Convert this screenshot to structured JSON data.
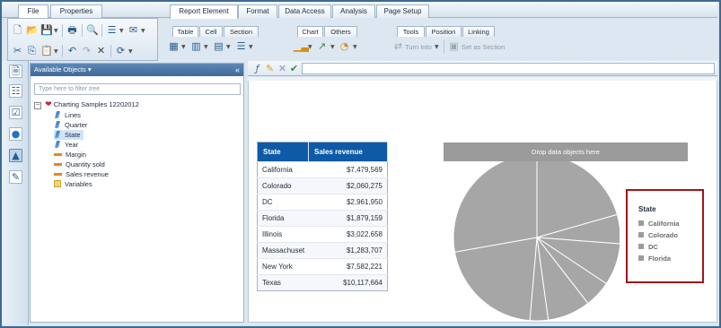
{
  "ribbon": {
    "tabs_left": [
      "File",
      "Properties"
    ],
    "tabs_main": [
      "Report Element",
      "Format",
      "Data Access",
      "Analysis",
      "Page Setup"
    ],
    "subtabs": [
      "Table",
      "Cell",
      "Section",
      "Chart",
      "Others",
      "Tools",
      "Position",
      "Linking"
    ],
    "turn_into": "Turn Into",
    "set_as_section": "Set as Section"
  },
  "objects_panel": {
    "title": "Available Objects",
    "filter_placeholder": "Type here to filter tree",
    "root": "Charting Samples 12202012",
    "items": [
      {
        "label": "Lines",
        "kind": "dimension"
      },
      {
        "label": "Quarter",
        "kind": "dimension"
      },
      {
        "label": "State",
        "kind": "dimension",
        "selected": true
      },
      {
        "label": "Year",
        "kind": "dimension"
      },
      {
        "label": "Margin",
        "kind": "measure"
      },
      {
        "label": "Quantity sold",
        "kind": "measure"
      },
      {
        "label": "Sales revenue",
        "kind": "measure"
      },
      {
        "label": "Variables",
        "kind": "folder"
      }
    ]
  },
  "table": {
    "headers": [
      "State",
      "Sales revenue"
    ],
    "rows": [
      [
        "California",
        "$7,479,569"
      ],
      [
        "Colorado",
        "$2,060,275"
      ],
      [
        "DC",
        "$2,961,950"
      ],
      [
        "Florida",
        "$1,879,159"
      ],
      [
        "Illinois",
        "$3,022,658"
      ],
      [
        "Massachuset",
        "$1,283,707"
      ],
      [
        "New York",
        "$7,582,221"
      ],
      [
        "Texas",
        "$10,117,664"
      ]
    ]
  },
  "chart": {
    "drop_hint": "Drop data objects here",
    "slice_color": "#a6a6a6",
    "legend_title": "State",
    "legend_items": [
      "California",
      "Colorado",
      "DC",
      "Florida"
    ]
  },
  "chart_data": {
    "type": "pie",
    "categories": [
      "California",
      "Colorado",
      "DC",
      "Florida",
      "Illinois",
      "Massachuset",
      "New York",
      "Texas"
    ],
    "values": [
      7479569,
      2060275,
      2961950,
      1879159,
      3022658,
      1283707,
      7582221,
      10117664
    ],
    "legend": "right",
    "title": ""
  },
  "colors": {
    "header_blue": "#0e5aa7",
    "legend_border": "#a51414",
    "drop_bar": "#9b9b9b"
  }
}
